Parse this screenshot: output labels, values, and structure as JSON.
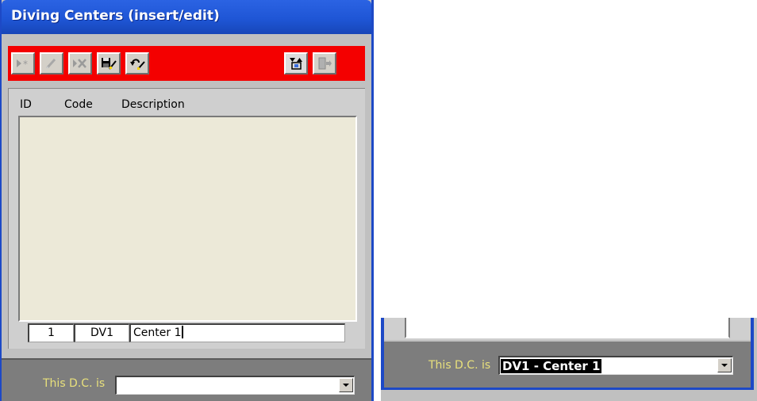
{
  "window": {
    "title": "Diving Centers (insert/edit)",
    "colors": {
      "titlebar": "#2160dd",
      "toolbar": "#f40000",
      "list_bg": "#ece9d8",
      "bottom_panel": "#7d7d7d",
      "label": "#e8e07c"
    }
  },
  "toolbar": {
    "buttons": [
      {
        "icon": "new-record-icon",
        "enabled": false
      },
      {
        "icon": "edit-pencil-icon",
        "enabled": false
      },
      {
        "icon": "delete-record-icon",
        "enabled": false
      },
      {
        "icon": "save-icon",
        "enabled": true
      },
      {
        "icon": "undo-icon",
        "enabled": true
      },
      {
        "icon": "toggle-view-icon",
        "enabled": true
      },
      {
        "icon": "exit-door-icon",
        "enabled": false
      }
    ]
  },
  "list": {
    "columns": [
      "ID",
      "Code",
      "Description"
    ],
    "edit_row": {
      "id": "1",
      "code": "DV1",
      "description": "Center 1"
    }
  },
  "dc_field": {
    "label": "This D.C. is",
    "value": ""
  },
  "zoom_view": {
    "label": "This D.C. is",
    "selected_value": "DV1 - Center 1"
  }
}
